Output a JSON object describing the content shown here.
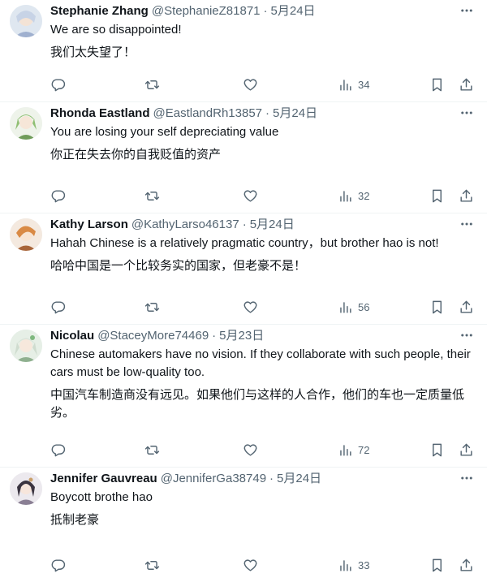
{
  "colors": {
    "text": "#0f1419",
    "secondary": "#536471",
    "divider": "#eff3f4",
    "background": "#ffffff"
  },
  "icons": {
    "reply": "reply-icon",
    "retweet": "retweet-icon",
    "like": "like-icon",
    "views": "views-icon",
    "bookmark": "bookmark-icon",
    "share": "share-icon",
    "more": "more-icon"
  },
  "tweets": [
    {
      "name": "Stephanie Zhang",
      "handle": "@StephanieZ81871",
      "separator": "·",
      "date": "5月24日",
      "text": "We are so disappointed!",
      "translation": "我们太失望了！",
      "views": "34",
      "avatar_color": "#c9d6e6"
    },
    {
      "name": "Rhonda Eastland",
      "handle": "@EastlandRh13857",
      "separator": "·",
      "date": "5月24日",
      "text": "You are losing your self depreciating value",
      "translation": "你正在失去你的自我贬值的资产",
      "views": "32",
      "avatar_color": "#a9c98f"
    },
    {
      "name": "Kathy Larson",
      "handle": "@KathyLarso46137",
      "separator": "·",
      "date": "5月24日",
      "text": "Hahah Chinese is a relatively pragmatic country，but brother hao is not!",
      "translation": "哈哈中国是一个比较务实的国家，但老豪不是！",
      "views": "56",
      "avatar_color": "#e0a46a"
    },
    {
      "name": "Nicolau",
      "handle": "@StaceyMore74469",
      "separator": "·",
      "date": "5月23日",
      "text": "Chinese automakers have no vision. If they collaborate with such people, their cars must be low-quality too.",
      "translation": "中国汽车制造商没有远见。如果他们与这样的人合作，他们的车也一定质量低劣。",
      "views": "72",
      "avatar_color": "#9fc7a5"
    },
    {
      "name": "Jennifer Gauvreau",
      "handle": "@JenniferGa38749",
      "separator": "·",
      "date": "5月24日",
      "text": "Boycott brothe hao",
      "translation": "抵制老豪",
      "views": "33",
      "avatar_color": "#b9b2bf"
    }
  ]
}
